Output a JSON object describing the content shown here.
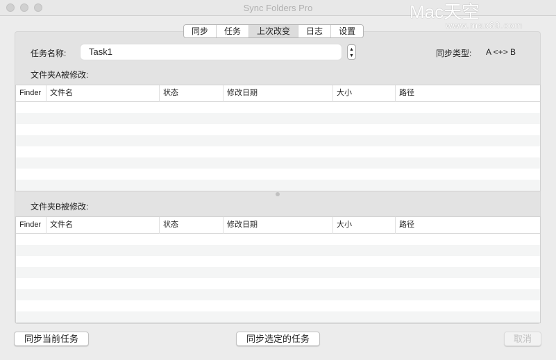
{
  "window": {
    "title": "Sync Folders Pro"
  },
  "watermark": {
    "brand": "Mac天空",
    "url": "www.mac69.com"
  },
  "tabs": [
    {
      "label": "同步"
    },
    {
      "label": "任务"
    },
    {
      "label": "上次改变",
      "active": true
    },
    {
      "label": "日志"
    },
    {
      "label": "设置"
    }
  ],
  "task": {
    "name_label": "任务名称:",
    "name_value": "Task1",
    "sync_type_label": "同步类型:",
    "sync_type_value": "A <+> B"
  },
  "folder_a": {
    "label": "文件夹A被修改:"
  },
  "folder_b": {
    "label": "文件夹B被修改:"
  },
  "columns": [
    "Finder",
    "文件名",
    "状态",
    "修改日期",
    "大小",
    "路径"
  ],
  "buttons": {
    "sync_current": "同步当前任务",
    "sync_selected": "同步选定的任务",
    "cancel": "取消"
  }
}
